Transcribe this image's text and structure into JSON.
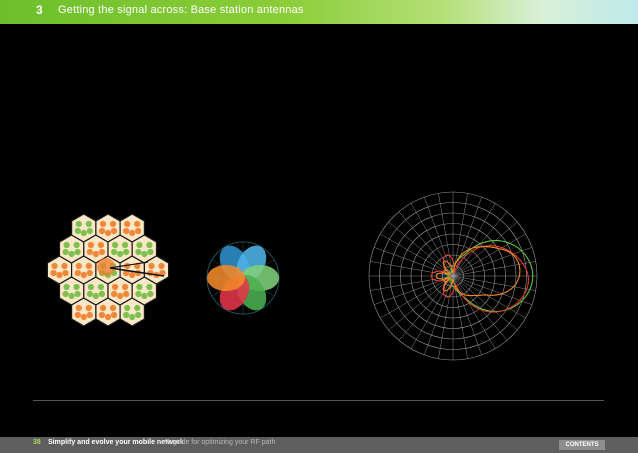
{
  "header": {
    "chapter": "3",
    "title": "Getting the signal across: Base station antennas"
  },
  "footer": {
    "page_number": "38",
    "publication": "Simplify and evolve your mobile network",
    "subtitle": "A guide for optimizing your RF path",
    "contents_label": "CONTENTS"
  },
  "colors": {
    "hex_fill": "#fce7c6",
    "orange": "#f07c28",
    "green": "#6fbb45",
    "red": "#e62030",
    "grid": "#9a9a9a",
    "trace_green": "#5fc544",
    "trace_red": "#e03a2a",
    "trace_orange": "#f08a24"
  },
  "figures": [
    {
      "kind": "hexagonal-cell-layout-diagram"
    },
    {
      "kind": "six-sector-lobe-diagram",
      "lobe_colors": [
        "#2f8fcc",
        "#4eb3e6",
        "#7fd07a",
        "#4caf50",
        "#e2364a",
        "#f08a2a"
      ]
    },
    {
      "kind": "polar-radiation-pattern-plot"
    }
  ]
}
